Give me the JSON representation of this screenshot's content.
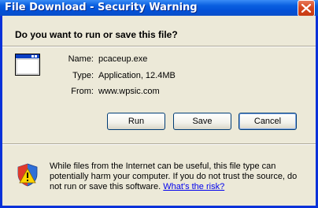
{
  "window": {
    "title": "File Download - Security Warning"
  },
  "dialog": {
    "question": "Do you want to run or save this file?",
    "file": {
      "name_label": "Name:",
      "name_value": "pcaceup.exe",
      "type_label": "Type:",
      "type_value": "Application, 12.4MB",
      "from_label": "From:",
      "from_value": "www.wpsic.com"
    },
    "buttons": {
      "run": "Run",
      "save": "Save",
      "cancel": "Cancel"
    },
    "warning": {
      "text": "While files from the Internet can be useful, this file type can potentially harm your computer. If you do not trust the source, do not run or save this software.",
      "link": "What's the risk?"
    }
  },
  "colors": {
    "title_bar": "#0a5fe0",
    "dialog_bg": "#ece9d8",
    "close_button": "#d6481f",
    "link": "#0000ee"
  },
  "icons": {
    "file": "application-window-icon",
    "warning": "security-shield-warning-icon",
    "close": "close-icon"
  }
}
